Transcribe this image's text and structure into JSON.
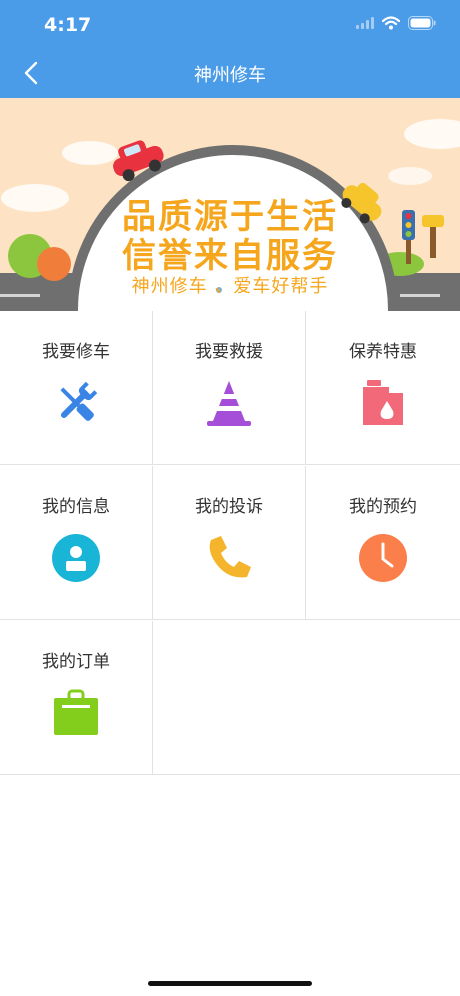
{
  "status_bar": {
    "time": "4:17"
  },
  "nav": {
    "title": "神州修车"
  },
  "banner": {
    "line1": "品质源于生活",
    "line2": "信誉来自服务",
    "line3": "神州修车 、爱车好帮手"
  },
  "menu": [
    {
      "label": "我要修车",
      "icon": "wrench-screwdriver-icon",
      "color": "#3a84e6"
    },
    {
      "label": "我要救援",
      "icon": "traffic-cone-icon",
      "color": "#a54fd9"
    },
    {
      "label": "保养特惠",
      "icon": "oil-can-icon",
      "color": "#f2697a"
    },
    {
      "label": "我的信息",
      "icon": "user-profile-icon",
      "color": "#19b5d6"
    },
    {
      "label": "我的投诉",
      "icon": "phone-icon",
      "color": "#f4b52c"
    },
    {
      "label": "我的预约",
      "icon": "clock-icon",
      "color": "#fb7f4a"
    },
    {
      "label": "我的订单",
      "icon": "shopping-bag-icon",
      "color": "#83cd1d"
    }
  ]
}
